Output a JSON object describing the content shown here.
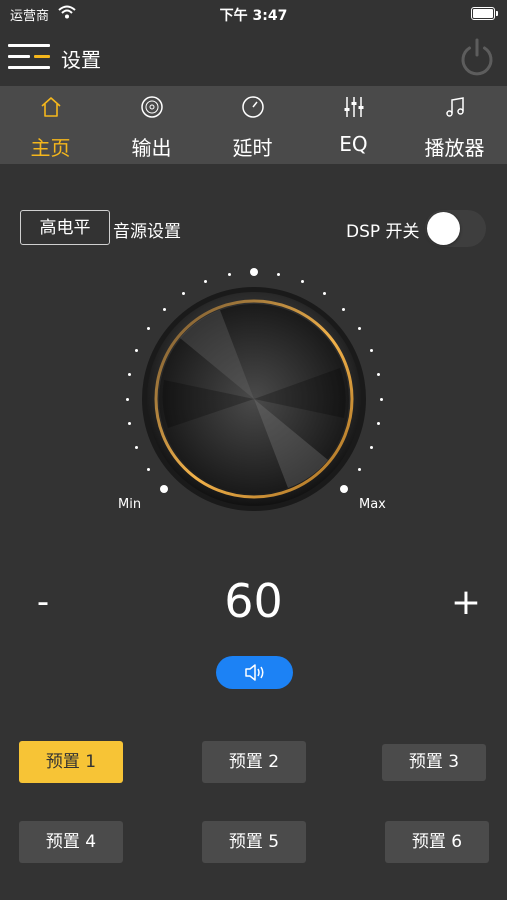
{
  "status_bar": {
    "carrier": "运营商",
    "time": "下午 3:47"
  },
  "nav": {
    "title": "设置",
    "icons": [
      "menu-icon",
      "power-icon"
    ]
  },
  "tabs": [
    {
      "label": "主页",
      "icon": "home-icon",
      "active": true
    },
    {
      "label": "输出",
      "icon": "disc-icon",
      "active": false
    },
    {
      "label": "延时",
      "icon": "timer-icon",
      "active": false
    },
    {
      "label": "EQ",
      "icon": "equalizer-icon",
      "active": false
    },
    {
      "label": "播放器",
      "icon": "music-note-icon",
      "active": false
    }
  ],
  "controls": {
    "level_button": "高电平",
    "source_label": "音源设置",
    "dsp_label": "DSP 开关",
    "dsp_enabled": false
  },
  "volume": {
    "min_label": "Min",
    "max_label": "Max",
    "value": "60",
    "minus": "-",
    "plus": "+",
    "mute_icon": "speaker-icon"
  },
  "presets": [
    {
      "label": "预置 1",
      "active": true
    },
    {
      "label": "预置 2",
      "active": false
    },
    {
      "label": "预置 3",
      "active": false
    },
    {
      "label": "预置 4",
      "active": false
    },
    {
      "label": "预置 5",
      "active": false
    },
    {
      "label": "预置 6",
      "active": false
    }
  ],
  "colors": {
    "accent": "#f5b71c",
    "preset_active": "#f7c436",
    "mute_blue": "#1c82f5",
    "background": "#333333",
    "tabbar": "#4a4a4a"
  }
}
